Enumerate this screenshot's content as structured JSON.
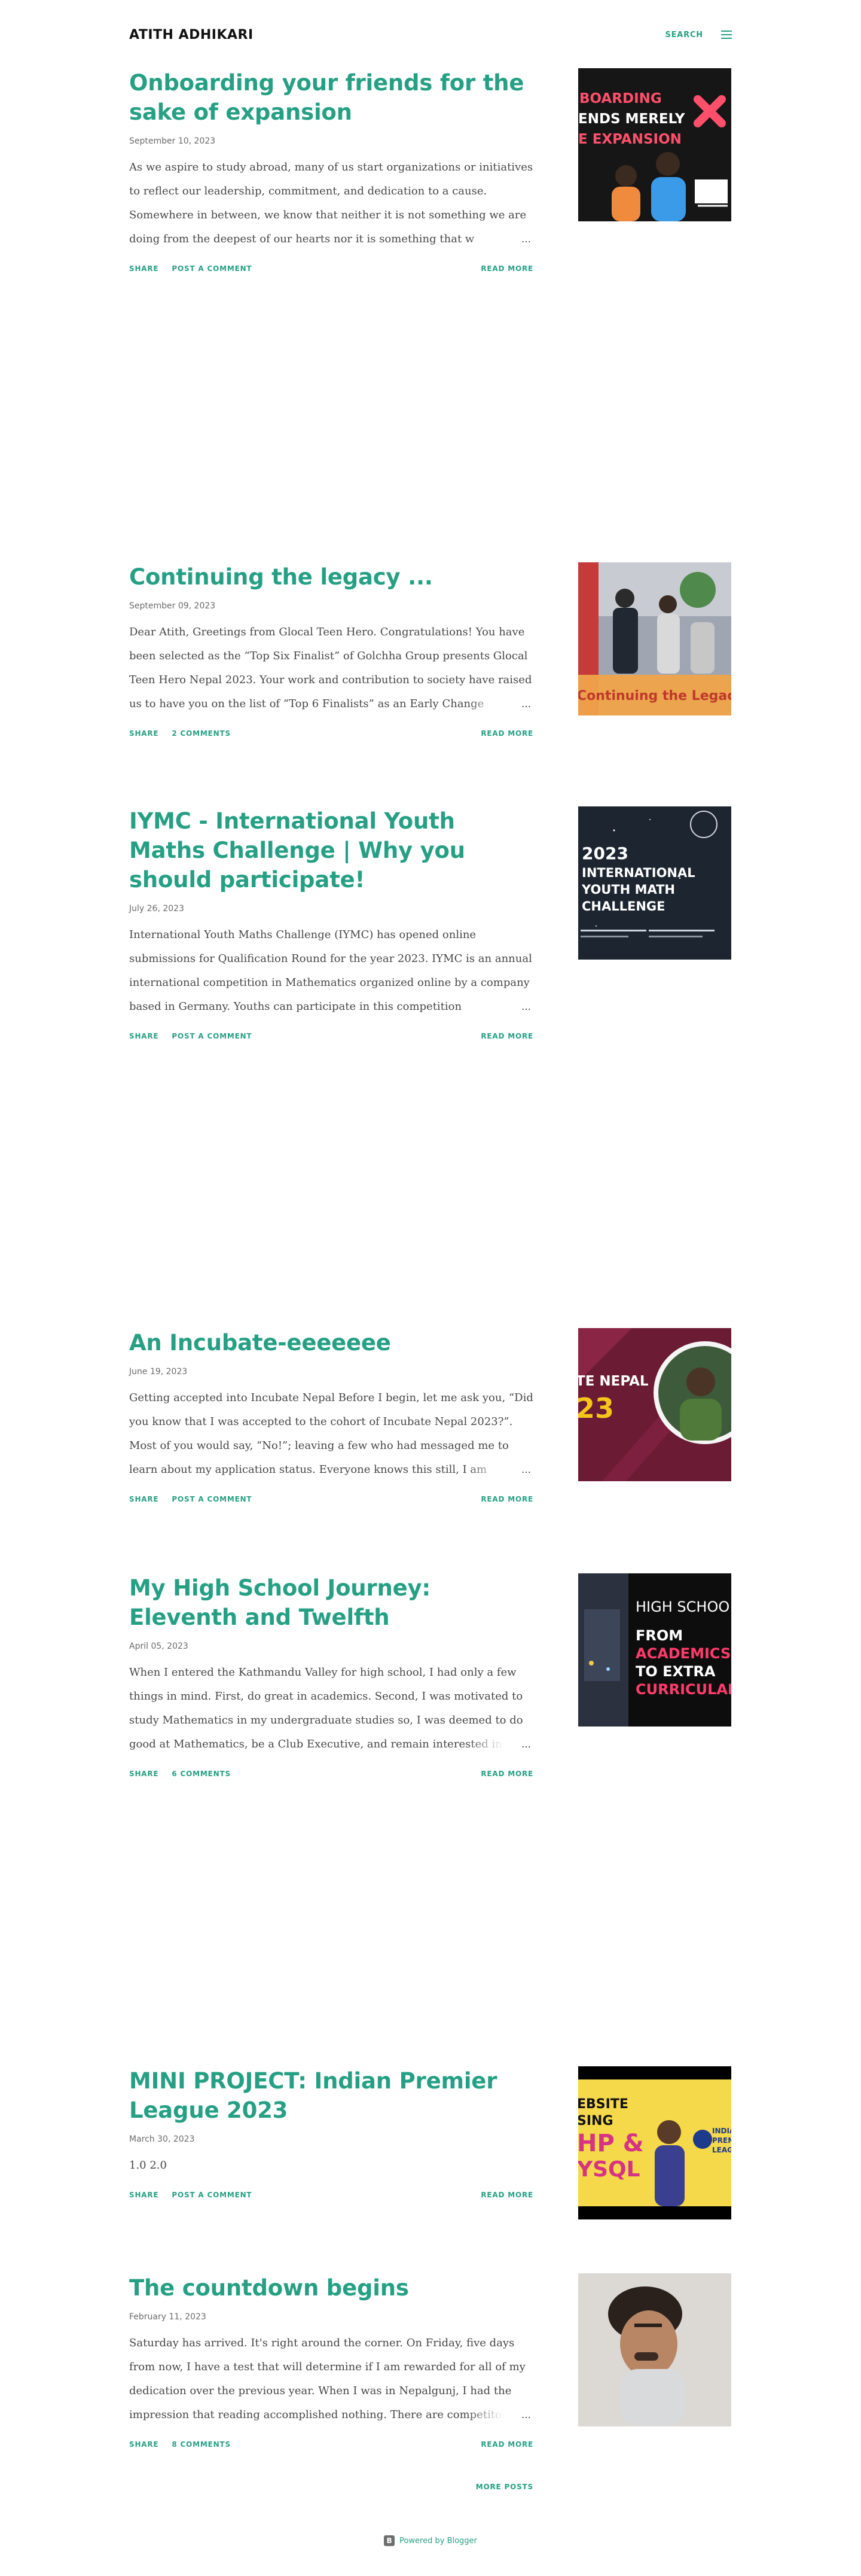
{
  "header": {
    "title": "ATITH ADHIKARI",
    "search_label": "SEARCH",
    "menu_icon": "hamburger-menu-icon"
  },
  "posts": [
    {
      "title": "Onboarding your friends for the sake of expansion",
      "date": "September 10, 2023",
      "snippet": "As we aspire to study abroad, many of us start organizations or initiatives to reflect our leadership, commitment, and dedication to a cause. Somewhere in between, we know that neither it is not something we are doing from the deepest of our hearts nor it is something that w",
      "share_label": "SHARE",
      "comments_label": "POST A COMMENT",
      "read_more_label": "READ MORE",
      "thumb_text": [
        "BOARDING",
        "ENDS MERELY",
        "E EXPANSION"
      ]
    },
    {
      "title": "Continuing the legacy ...",
      "date": "September 09, 2023",
      "snippet": "Dear Atith,  Greetings from Glocal Teen Hero. Congratulations! You have been selected as the “Top Six Finalist” of Golchha Group presents Glocal Teen Hero Nepal 2023. Your work and contribution to society have raised us to have you on the list of “Top 6 Finalists” as an Early Change",
      "share_label": "SHARE",
      "comments_label": "2 COMMENTS",
      "read_more_label": "READ MORE",
      "thumb_text": [
        "Continuing the Legacy"
      ]
    },
    {
      "title": "IYMC - International Youth Maths Challenge | Why you should participate!",
      "date": "July 26, 2023",
      "snippet": "International Youth Maths Challenge (IYMC) has opened online submissions for Qualification Round for the year 2023. IYMC is an annual international competition in Mathematics organized online by a company based in Germany. Youths can participate in this competition",
      "share_label": "SHARE",
      "comments_label": "POST A COMMENT",
      "read_more_label": "READ MORE",
      "thumb_text": [
        "2023",
        "INTERNATIONAL",
        "YOUTH MATH",
        "CHALLENGE"
      ]
    },
    {
      "title": "An Incubate-eeeeeee",
      "date": "June 19, 2023",
      "snippet": "Getting accepted into Incubate Nepal Before I begin, let me ask you, “Did you know that I was accepted to the cohort of Incubate Nepal 2023?”. Most of you would say, “No!”; leaving a few who had messaged me to learn about my application status. Everyone knows this still, I am",
      "share_label": "SHARE",
      "comments_label": "POST A COMMENT",
      "read_more_label": "READ MORE",
      "thumb_text": [
        "TE NEPAL",
        "23"
      ]
    },
    {
      "title": "My High School Journey: Eleventh and Twelfth",
      "date": "April 05, 2023",
      "snippet": "When I entered the Kathmandu Valley for high school, I had only a few things in mind. First, do great in academics. Second, I was motivated to study Mathematics in my undergraduate studies so, I was deemed to do good at Mathematics, be a Club Executive, and remain interested in",
      "share_label": "SHARE",
      "comments_label": "6 COMMENTS",
      "read_more_label": "READ MORE",
      "thumb_text": [
        "HIGH SCHOO",
        "FROM",
        "ACADEMICS",
        "TO EXTRA",
        "CURRICULAR"
      ]
    },
    {
      "title": "MINI PROJECT: Indian Premier League 2023",
      "date": "March 30, 2023",
      "snippet": "1.0 2.0",
      "share_label": "SHARE",
      "comments_label": "POST A COMMENT",
      "read_more_label": "READ MORE",
      "thumb_text": [
        "EBSITE",
        "SING",
        "HP &",
        "YSQL",
        "INDIA",
        "PREM",
        "LEAG"
      ]
    },
    {
      "title": "The countdown begins",
      "date": "February 11, 2023",
      "snippet": "Saturday has arrived. It's right around the corner. On Friday, five days from now, I have a test that will determine if I am rewarded for all of my dedication over the previous year. When I was in Nepalgunj, I had the impression that reading accomplished nothing. There are competitors",
      "share_label": "SHARE",
      "comments_label": "8 COMMENTS",
      "read_more_label": "READ MORE",
      "thumb_text": []
    }
  ],
  "more_posts_label": "MORE POSTS",
  "footer": {
    "powered_by": "Powered by Blogger",
    "blogger_icon": "blogger-icon",
    "blogger_icon_glyph": "B"
  },
  "colors": {
    "accent": "#26a085",
    "text": "#474747",
    "date": "#6b6b6b"
  }
}
